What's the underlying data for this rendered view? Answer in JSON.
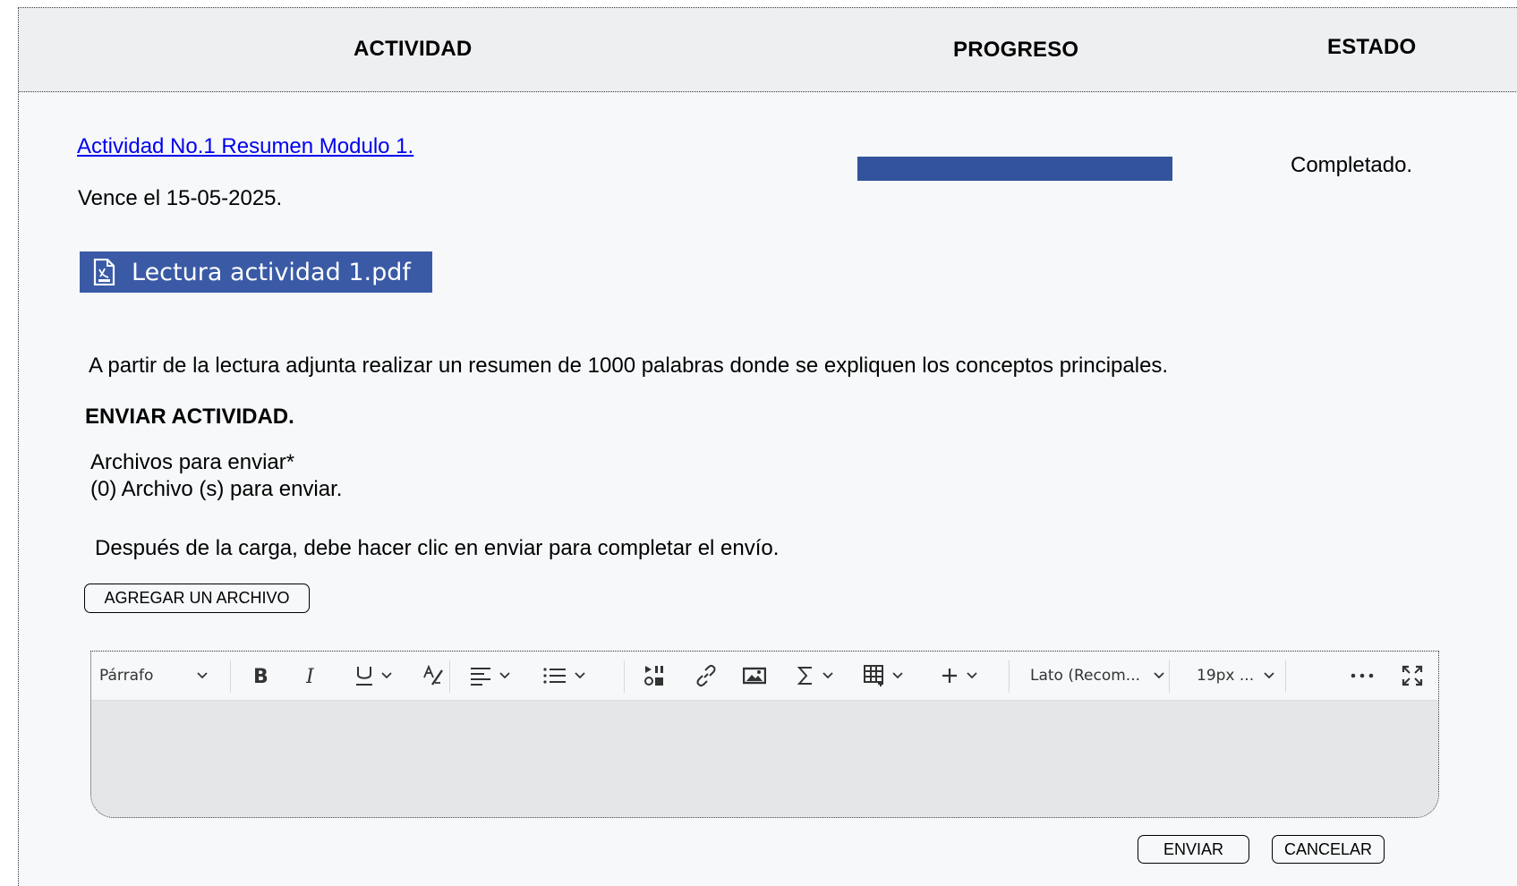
{
  "table_header": {
    "activity": "ACTIVIDAD",
    "progress": "PROGRESO",
    "status": "ESTADO"
  },
  "activity": {
    "title": "Actividad No.1 Resumen Modulo 1.",
    "due_date": "Vence el 15-05-2025.",
    "progress_fraction": 1.0,
    "progress_color": "#33549d",
    "status": "Completado.",
    "attachment": {
      "name": "Lectura actividad 1.pdf",
      "icon": "pdf-file-icon",
      "color": "#3a5aa5"
    },
    "instructions": "A partir de la lectura adjunta realizar un resumen de 1000 palabras donde se expliquen los conceptos principales."
  },
  "submission": {
    "title": "ENVIAR ACTIVIDAD.",
    "files_label": "Archivos para enviar*",
    "files_count": "(0) Archivo (s) para enviar.",
    "note": "Después de la carga, debe hacer clic en enviar para completar el envío.",
    "add_file_label": "AGREGAR UN ARCHIVO",
    "send_label": "ENVIAR",
    "cancel_label": "CANCELAR"
  },
  "editor": {
    "paragraph_style": "Párrafo",
    "font_family": "Lato (Recom...",
    "font_size": "19px ...",
    "icons": [
      "bold-icon",
      "italic-icon",
      "underline-icon",
      "clear-format-icon",
      "align-icon",
      "list-icon",
      "insert-stuff-icon",
      "link-icon",
      "image-icon",
      "equation-icon",
      "table-icon",
      "insert-more-icon",
      "more-options-icon",
      "fullscreen-icon"
    ]
  }
}
